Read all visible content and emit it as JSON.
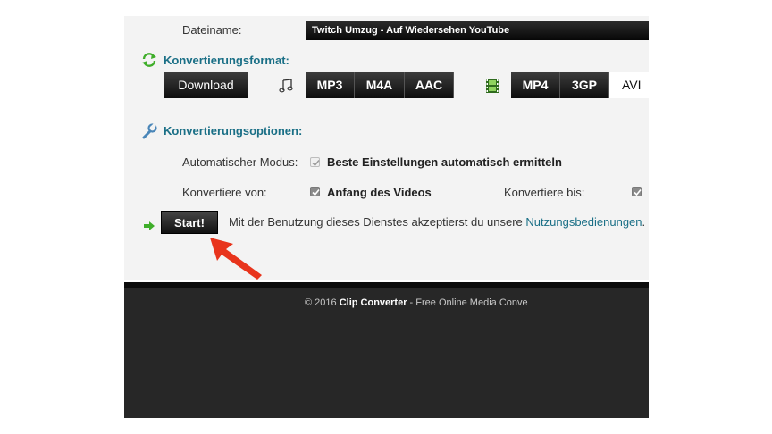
{
  "form": {
    "filename_label": "Dateiname:",
    "filename_value": "Twitch Umzug - Auf Wiedersehen YouTube"
  },
  "format": {
    "heading": "Konvertierungsformat:",
    "heading_icon": "refresh-arrows-icon",
    "download_label": "Download",
    "audio_icon": "music-note-icon",
    "audio_buttons": [
      "MP3",
      "M4A",
      "AAC"
    ],
    "video_icon": "film-strip-icon",
    "video_buttons": [
      "MP4",
      "3GP",
      "AVI"
    ],
    "selected_video": "AVI"
  },
  "options": {
    "heading": "Konvertierungsoptionen:",
    "heading_icon": "wrench-icon",
    "auto_mode_label": "Automatischer Modus:",
    "auto_mode_text": "Beste Einstellungen automatisch ermitteln",
    "from_label": "Konvertiere von:",
    "from_text": "Anfang des Videos",
    "to_label": "Konvertiere bis:"
  },
  "start": {
    "button_label": "Start!",
    "agree_text": "Mit der Benutzung dieses Dienstes akzeptierst du unsere ",
    "agree_link": "Nutzungsbedienungen",
    "agree_end": "."
  },
  "footer": {
    "copyright": "© 2016 ",
    "brand": "Clip Converter",
    "tagline": " - Free Online Media Conve"
  },
  "colors": {
    "accent": "#1a6f86",
    "arrow": "#e8341c",
    "footer_bg": "#272727"
  }
}
